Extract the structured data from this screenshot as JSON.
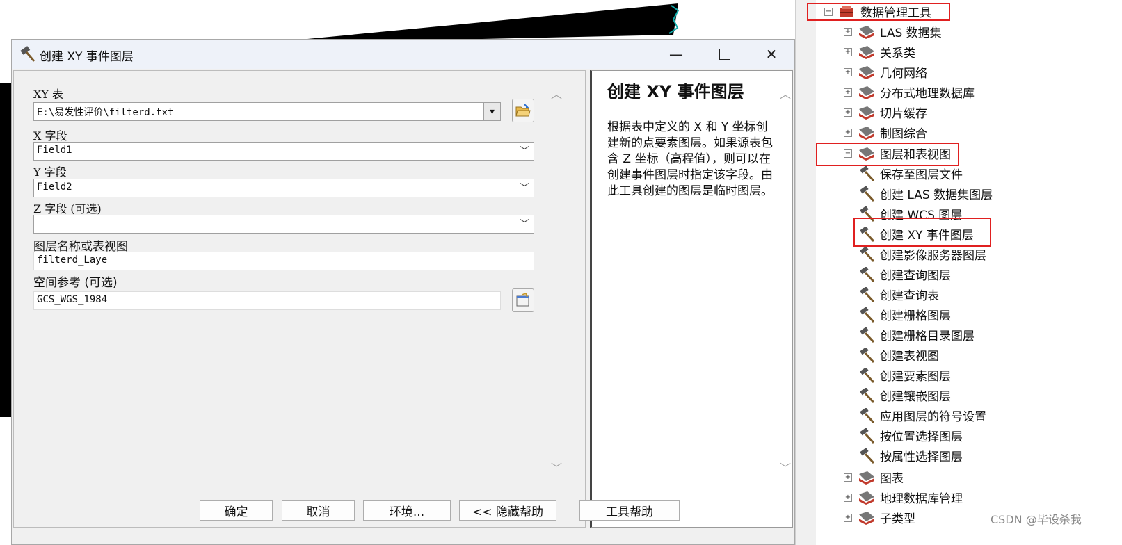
{
  "dialog": {
    "title": "创建 XY 事件图层",
    "window_controls": {
      "minimize": "—",
      "close": "✕"
    },
    "fields": {
      "xy_table": {
        "label": "XY 表",
        "value": "E:\\易发性评价\\filterd.txt"
      },
      "x_field": {
        "label": "X 字段",
        "value": "Field1"
      },
      "y_field": {
        "label": "Y 字段",
        "value": "Field2"
      },
      "z_field": {
        "label": "Z 字段 (可选)",
        "value": ""
      },
      "layer_name": {
        "label": "图层名称或表视图",
        "value": "filterd_Laye"
      },
      "spatial_ref": {
        "label": "空间参考 (可选)",
        "value": "GCS_WGS_1984"
      }
    },
    "help": {
      "title": "创建 XY 事件图层",
      "body": "根据表中定义的 X 和 Y 坐标创建新的点要素图层。如果源表包含 Z 坐标（高程值），则可以在创建事件图层时指定该字段。由此工具创建的图层是临时图层。"
    },
    "buttons": {
      "ok": "确定",
      "cancel": "取消",
      "env": "环境...",
      "hide_help": "<< 隐藏帮助",
      "tool_help": "工具帮助"
    }
  },
  "tree": {
    "root": {
      "label": "数据管理工具",
      "expander": "−"
    },
    "toolsets_top": [
      {
        "label": "LAS 数据集",
        "expander": "+"
      },
      {
        "label": "关系类",
        "expander": "+"
      },
      {
        "label": "几何网络",
        "expander": "+"
      },
      {
        "label": "分布式地理数据库",
        "expander": "+"
      },
      {
        "label": "切片缓存",
        "expander": "+"
      },
      {
        "label": "制图综合",
        "expander": "+"
      }
    ],
    "open_toolset": {
      "label": "图层和表视图",
      "expander": "−"
    },
    "tools": [
      "保存至图层文件",
      "创建 LAS 数据集图层",
      "创建 WCS 图层",
      "创建 XY 事件图层",
      "创建影像服务器图层",
      "创建查询图层",
      "创建查询表",
      "创建栅格图层",
      "创建栅格目录图层",
      "创建表视图",
      "创建要素图层",
      "创建镶嵌图层",
      "应用图层的符号设置",
      "按位置选择图层",
      "按属性选择图层"
    ],
    "toolsets_bottom": [
      {
        "label": "图表",
        "expander": "+"
      },
      {
        "label": "地理数据库管理",
        "expander": "+"
      },
      {
        "label": "子类型",
        "expander": "+"
      }
    ]
  },
  "watermark": "CSDN @毕设杀我",
  "colors": {
    "highlight": "#e02020",
    "toolbox_red": "#c0392b"
  }
}
